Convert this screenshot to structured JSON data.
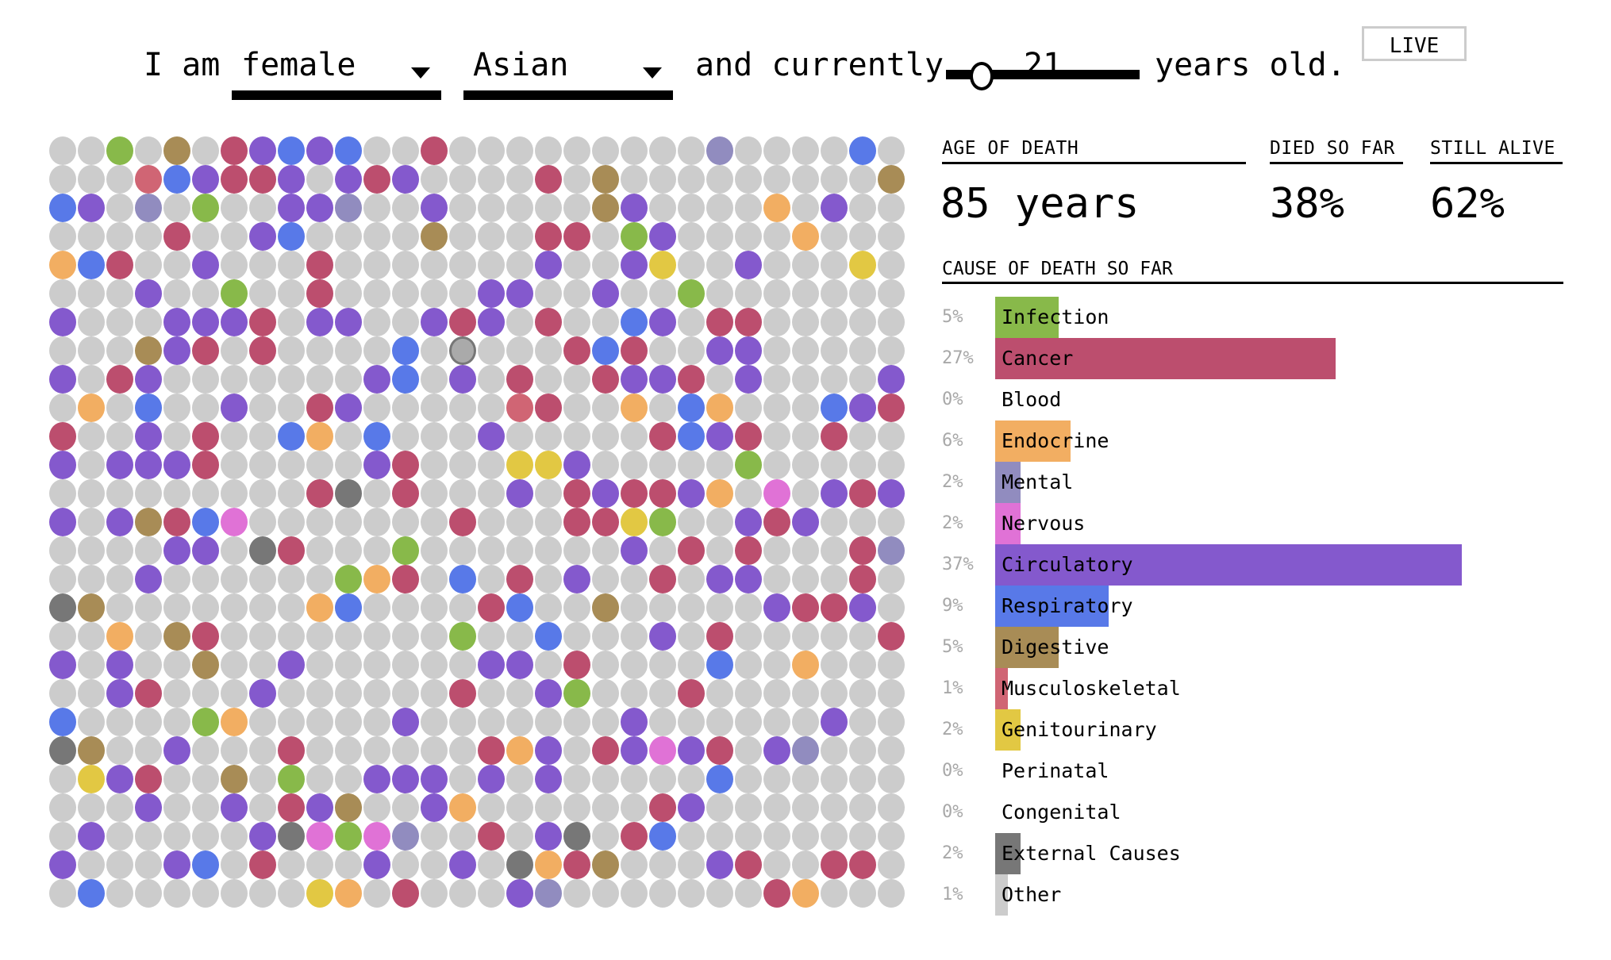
{
  "header": {
    "prefix": "I am",
    "sex_select": {
      "value": "female"
    },
    "race_select": {
      "value": "Asian"
    },
    "middle": "and currently",
    "age": {
      "value": "21",
      "slider_fraction": 0.18
    },
    "suffix": "years old.",
    "live_button": "LIVE"
  },
  "stats": {
    "age_of_death_label": "AGE OF DEATH",
    "age_of_death_value": "85 years",
    "died_label": "DIED SO FAR",
    "died_value": "38%",
    "alive_label": "STILL ALIVE",
    "alive_value": "62%",
    "cause_title": "CAUSE OF DEATH SO FAR"
  },
  "colors": {
    "alive": "#cccccc",
    "you": "#aaaaaa"
  },
  "causes": [
    {
      "key": "I",
      "name": "Infection",
      "pct_label": "5%",
      "pct": 5,
      "color": "#88b94a"
    },
    {
      "key": "C",
      "name": "Cancer",
      "pct_label": "27%",
      "pct": 27,
      "color": "#bc4e6e"
    },
    {
      "key": "B",
      "name": "Blood",
      "pct_label": "0%",
      "pct": 0,
      "color": "#cc3333"
    },
    {
      "key": "E",
      "name": "Endocrine",
      "pct_label": "6%",
      "pct": 6,
      "color": "#f2ae62"
    },
    {
      "key": "M",
      "name": "Mental",
      "pct_label": "2%",
      "pct": 2,
      "color": "#918cbf"
    },
    {
      "key": "N",
      "name": "Nervous",
      "pct_label": "2%",
      "pct": 2,
      "color": "#e072d6"
    },
    {
      "key": "V",
      "name": "Circulatory",
      "pct_label": "37%",
      "pct": 37,
      "color": "#8459cd"
    },
    {
      "key": "R",
      "name": "Respiratory",
      "pct_label": "9%",
      "pct": 9,
      "color": "#5879e8"
    },
    {
      "key": "D",
      "name": "Digestive",
      "pct_label": "5%",
      "pct": 5,
      "color": "#a88c56"
    },
    {
      "key": "K",
      "name": "Musculoskeletal",
      "pct_label": "1%",
      "pct": 1,
      "color": "#d06574"
    },
    {
      "key": "G",
      "name": "Genitourinary",
      "pct_label": "2%",
      "pct": 2,
      "color": "#e2c843"
    },
    {
      "key": "P",
      "name": "Perinatal",
      "pct_label": "0%",
      "pct": 0,
      "color": "#999999"
    },
    {
      "key": "Q",
      "name": "Congenital",
      "pct_label": "0%",
      "pct": 0,
      "color": "#999999"
    },
    {
      "key": "X",
      "name": "External Causes",
      "pct_label": "2%",
      "pct": 2,
      "color": "#777777"
    },
    {
      "key": "O",
      "name": "Other",
      "pct_label": "1%",
      "pct": 1,
      "color": "#cccccc"
    }
  ],
  "population_grid": {
    "columns": 30,
    "legend": ". = still alive, S = you, other letters = cause key",
    "rows": [
      "..I.D.CVRVR..C.........M....R.",
      "...KRVCCV.VCV....C.D.........D",
      "RV.M.I..VVM..V.....DV....E.V..",
      "....C..VR....D...CC.IV....E...",
      "ERC..V...C.......V..VG..V...G.",
      "...V..I..C.....VV..V..I.......",
      "V...VVVC.VV..VCV.C..RV.CC.....",
      "...DVC.C....R.S...CRC..VV.....",
      "V.CV.......VR.V.C..CVVC.V....V",
      ".E.R..V..CV.....KC..E.RE...RVC",
      "C..V.C..RE.R...V.....CRVC..C..",
      "V.VVVC.....VC...GGV.....I.....",
      ".........CX.C...V.CVCCVE.N.VCV",
      "V.VDCRN.......C...CCGI..VCV...",
      "....VV.XC...I.......V.C.C...CM",
      "...V......IEC.R.C.V..C.VV...C.",
      "XD.......ER....CR..D.....VCCV.",
      "..E.DC........I..R...V.C.....C",
      "V.V..D..V......VV.C....R..E...",
      "..VC...V......C..VI...C.......",
      "R....IE.....V.......V......V..",
      "XD..V...C......CEV.CVNVC.VM...",
      ".GVC..D.I..VVV.V.V.....R......",
      "...V..V.CVD..VE......CV.......",
      ".V.....VXNINM..C.VX.CR........",
      "V...VR.C...V..V.XECD...VC..CC.",
      ".R.......GE.C...VM.......CE..."
    ]
  }
}
